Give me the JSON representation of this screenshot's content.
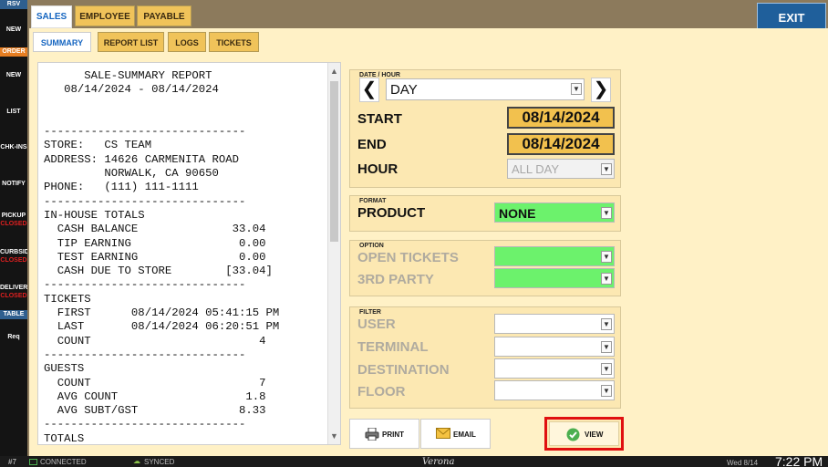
{
  "sidebar": {
    "items": [
      {
        "label": "RSV",
        "kind": "hdr"
      },
      {
        "label": "NEW",
        "kind": "item"
      },
      {
        "label": "ORDER",
        "kind": "hdr-orange"
      },
      {
        "label": "NEW",
        "kind": "item"
      },
      {
        "label": "LIST",
        "kind": "item"
      },
      {
        "label": "CHK-INS",
        "kind": "item"
      },
      {
        "label": "NOTIFY",
        "kind": "item"
      },
      {
        "label": "PICKUP",
        "status": "CLOSED"
      },
      {
        "label": "CURBSID",
        "status": "CLOSED"
      },
      {
        "label": "DELIVER",
        "status": "CLOSED"
      },
      {
        "label": "TABLE",
        "kind": "hdr"
      },
      {
        "label": "Req",
        "kind": "item"
      }
    ]
  },
  "top_tabs": [
    "SALES",
    "EMPLOYEE",
    "PAYABLE"
  ],
  "exit_label": "EXIT",
  "sub_tabs": [
    "SUMMARY",
    "REPORT LIST",
    "LOGS",
    "TICKETS"
  ],
  "report_lines": [
    "      SALE-SUMMARY REPORT",
    "   08/14/2024 - 08/14/2024",
    "",
    "",
    "------------------------------",
    "STORE:   CS TEAM",
    "ADDRESS: 14626 CARMENITA ROAD",
    "         NORWALK, CA 90650",
    "PHONE:   (111) 111-1111",
    "------------------------------",
    "IN-HOUSE TOTALS",
    "  CASH BALANCE              33.04",
    "  TIP EARNING                0.00",
    "  TEST EARNING               0.00",
    "  CASH DUE TO STORE        [33.04]",
    "------------------------------",
    "TICKETS",
    "  FIRST      08/14/2024 05:41:15 PM",
    "  LAST       08/14/2024 06:20:51 PM",
    "  COUNT                         4",
    "------------------------------",
    "GUESTS",
    "  COUNT                         7",
    "  AVG COUNT                   1.8",
    "  AVG SUBT/GST               8.33",
    "------------------------------",
    "TOTALS"
  ],
  "date_hour": {
    "title": "DATE / HOUR",
    "period": "DAY",
    "start_label": "START",
    "start_value": "08/14/2024",
    "end_label": "END",
    "end_value": "08/14/2024",
    "hour_label": "HOUR",
    "hour_value": "ALL DAY"
  },
  "format": {
    "title": "FORMAT",
    "product_label": "PRODUCT",
    "product_value": "NONE"
  },
  "option": {
    "title": "OPTION",
    "open_tickets_label": "OPEN TICKETS",
    "third_party_label": "3RD PARTY"
  },
  "filter": {
    "title": "FILTER",
    "user_label": "USER",
    "terminal_label": "TERMINAL",
    "destination_label": "DESTINATION",
    "floor_label": "FLOOR"
  },
  "buttons": {
    "print": "PRINT",
    "email": "EMAIL",
    "view": "VIEW"
  },
  "status": {
    "terminal": "#7",
    "connection": "CONNECTED",
    "sync": "SYNCED",
    "brand": "Verona",
    "date": "Wed 8/14",
    "time": "7:22 PM"
  },
  "colors": {
    "accent_blue": "#1565c0",
    "tab_yellow": "#f0c35a",
    "panel_cream": "#fff1c6",
    "green": "#6cf26c",
    "highlight_red": "#e01010"
  }
}
